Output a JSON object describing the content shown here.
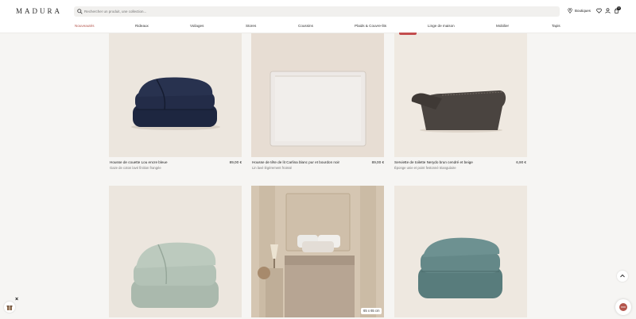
{
  "header": {
    "logo": "MADURA",
    "search_placeholder": "Rechercher un produit, une collection...",
    "stores_label": "Boutiques",
    "cart_count": "0"
  },
  "nav": {
    "items": [
      {
        "label": "Nouveautés",
        "active": true
      },
      {
        "label": "Rideaux"
      },
      {
        "label": "Voilages"
      },
      {
        "label": "Stores"
      },
      {
        "label": "Coussins"
      },
      {
        "label": "Plaids & Couvre-lits"
      },
      {
        "label": "Linge de maison"
      },
      {
        "label": "Mobilier"
      },
      {
        "label": "Tapis"
      }
    ]
  },
  "products": [
    {
      "title": "Housse de couette Lou encre bleue",
      "price": "89,00 €",
      "subtitle": "Gaze de coton lavé finition frangée",
      "icon": "folded-navy-duvet"
    },
    {
      "title": "Housse de tête de lit Carlina blanc pur et bourdon noir",
      "price": "89,00 €",
      "subtitle": "Lin lavé légèrement froissé",
      "icon": "white-headboard-cover"
    },
    {
      "title": "Serviette de toilette Nerydo brun cendré et beige",
      "price": "6,90 €",
      "subtitle": "Éponge unie et point festonné triangulaire",
      "icon": "folded-brown-towel"
    },
    {
      "title": "",
      "price": "",
      "subtitle": "",
      "icon": "folded-sage-duvet"
    },
    {
      "title": "",
      "price": "",
      "subtitle": "",
      "icon": "bedroom-scene",
      "size_tag": "65 x 65 cm"
    },
    {
      "title": "",
      "price": "",
      "subtitle": "",
      "icon": "folded-teal-duvet"
    }
  ],
  "colors": {
    "accent": "#b4564d",
    "background": "#f6f5f3",
    "photo_bg": "#ebe4db"
  }
}
